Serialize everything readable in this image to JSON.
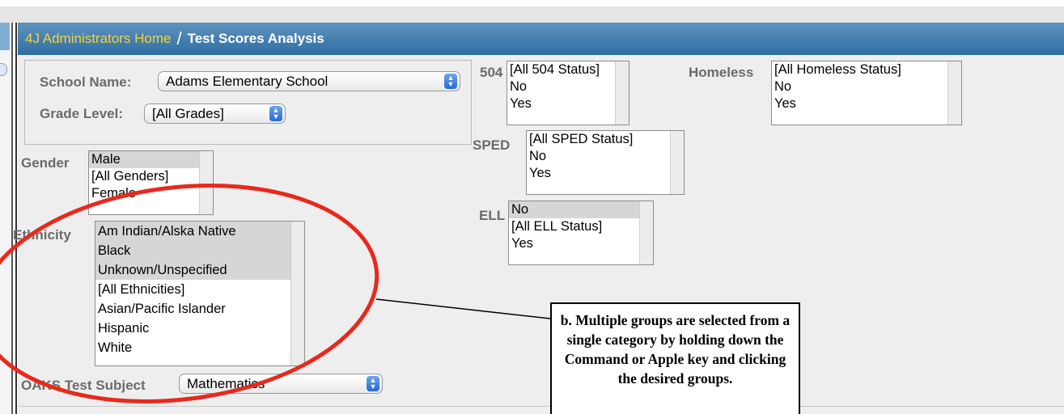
{
  "breadcrumb": {
    "home": "4J Administrators Home",
    "separator": "/",
    "current": "Test Scores Analysis"
  },
  "filters": {
    "school_name": {
      "label": "School Name:",
      "value": "Adams Elementary School"
    },
    "grade_level": {
      "label": "Grade Level:",
      "value": "[All Grades]"
    },
    "gender": {
      "label": "Gender",
      "options": [
        {
          "text": "Male",
          "selected": true
        },
        {
          "text": "[All Genders]",
          "selected": false
        },
        {
          "text": "Female",
          "selected": false
        }
      ]
    },
    "ethnicity": {
      "label": "Ethnicity",
      "options": [
        {
          "text": "Am Indian/Alska Native",
          "selected": true
        },
        {
          "text": "Black",
          "selected": true
        },
        {
          "text": "Unknown/Unspecified",
          "selected": true
        },
        {
          "text": "[All Ethnicities]",
          "selected": false
        },
        {
          "text": "Asian/Pacific Islander",
          "selected": false
        },
        {
          "text": "Hispanic",
          "selected": false
        },
        {
          "text": "White",
          "selected": false
        }
      ]
    },
    "oaks_test_subject": {
      "label": "OAKS Test Subject",
      "value": "Mathematics"
    },
    "s504": {
      "label": "504",
      "options": [
        {
          "text": "[All 504 Status]",
          "selected": false
        },
        {
          "text": "No",
          "selected": false
        },
        {
          "text": "Yes",
          "selected": false
        }
      ]
    },
    "sped": {
      "label": "SPED",
      "options": [
        {
          "text": "[All SPED Status]",
          "selected": false
        },
        {
          "text": "No",
          "selected": false
        },
        {
          "text": "Yes",
          "selected": false
        }
      ]
    },
    "ell": {
      "label": "ELL",
      "options": [
        {
          "text": "No",
          "selected": true
        },
        {
          "text": "[All ELL Status]",
          "selected": false
        },
        {
          "text": "Yes",
          "selected": false
        }
      ]
    },
    "homeless": {
      "label": "Homeless",
      "options": [
        {
          "text": "[All Homeless Status]",
          "selected": false
        },
        {
          "text": "No",
          "selected": false
        },
        {
          "text": "Yes",
          "selected": false
        }
      ]
    }
  },
  "annotation": {
    "callout_text": "b. Multiple groups are selected from a single category by holding down the Command or Apple key and clicking the desired groups.",
    "ellipse_color": "#e8291c",
    "line_color": "#000000"
  },
  "icons": {
    "select_arrows": "updown-arrows-icon"
  },
  "colors": {
    "header_top": "#5f93c0",
    "header_bottom": "#2f6ea3",
    "home_link": "#f4d43a",
    "label_gray": "#6b6b6b"
  }
}
